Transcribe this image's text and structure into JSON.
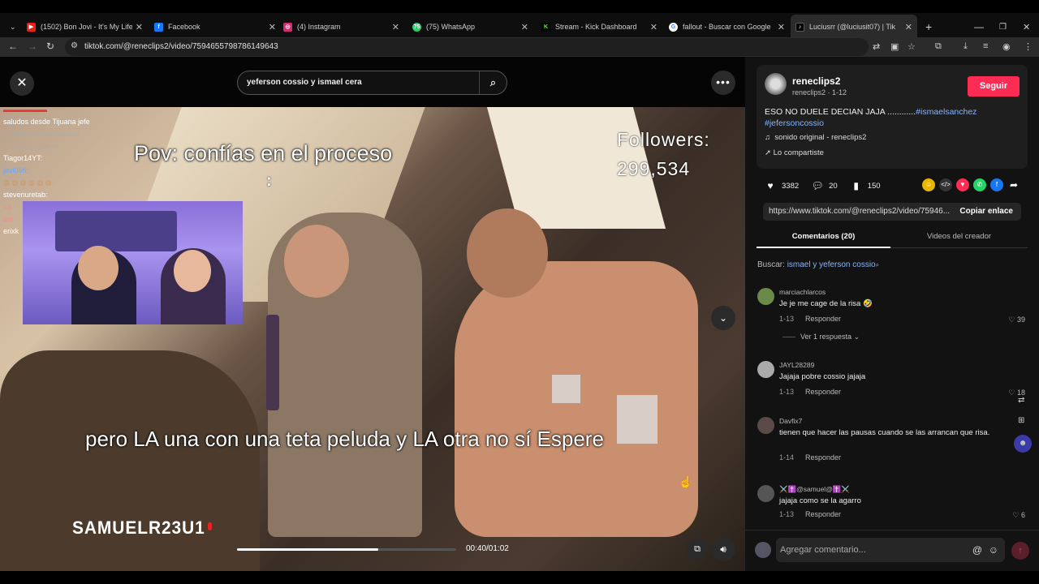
{
  "browser": {
    "tabs": [
      {
        "label": "(1502) Bon Jovi - It's My Life (O",
        "icon": "youtube-icon",
        "color": "#e62117"
      },
      {
        "label": "Facebook",
        "icon": "facebook-icon",
        "color": "#1877f2"
      },
      {
        "label": "(4) Instagram",
        "icon": "instagram-icon",
        "color": "#d62976"
      },
      {
        "label": "(75) WhatsApp",
        "icon": "whatsapp-icon",
        "color": "#25d366"
      },
      {
        "label": "Stream - Kick Dashboard",
        "icon": "kick-icon",
        "color": "#53fc18"
      },
      {
        "label": "fallout - Buscar con Google",
        "icon": "google-icon",
        "color": "#4285f4"
      },
      {
        "label": "Luciusrr (@luciusit07) | Tik",
        "icon": "tiktok-icon",
        "color": "#000000"
      }
    ],
    "url": "tiktok.com/@reneclips2/video/7594655798786149643"
  },
  "video": {
    "search_value": "yeferson cossio y ismael cera",
    "pov_text": "Pov: confías en el proceso",
    "colon": ":",
    "followers_label": "Followers:",
    "followers_count": "299,534",
    "bottom_text": "pero LA una con una teta peluda y LA otra no sí Espere",
    "watermark": "SAMUELR23U1",
    "time": "00:40/01:02",
    "progress": 0.645,
    "chat_lines": [
      "saludos desde Tijuana jefe",
      "Tiagor14YT:",
      "javi066:",
      "stevenuretab:",
      "sa",
      "sm",
      "erixk"
    ]
  },
  "panel": {
    "username": "reneclips2",
    "usersub": "reneclips2 · 1-12",
    "follow_label": "Seguir",
    "caption_text": "ESO NO DUELE DECIAN JAJA ............",
    "caption_tag1": "#ismaelsanchez",
    "caption_tag2": "#jefersoncossio",
    "sound": "sonido original - reneclips2",
    "shared": "Lo compartiste",
    "likes": "3382",
    "comments_count": "20",
    "saves": "150",
    "link": "https://www.tiktok.com/@reneclips2/video/75946...",
    "copy_label": "Copiar enlace",
    "tab_comments": "Comentarios (20)",
    "tab_videos": "Videos del creador",
    "buscar_label": "Buscar:",
    "buscar_term": "ismael y yeferson cossio",
    "comments": [
      {
        "user": "marciachlarcos",
        "text": "Je je me cage de la risa 🤣",
        "date": "1-13",
        "likes": "39"
      },
      {
        "user": "JAYL28289",
        "text": "Jajaja pobre cossio jajaja",
        "date": "1-13",
        "likes": "18"
      },
      {
        "user": "Davfix7",
        "text": "tienen que hacer las pausas cuando se las arrancan que risa.",
        "date": "1-14",
        "likes": ""
      },
      {
        "user": "⚔️✝️@samuel@✝️⚔️",
        "text": "jajaja como se la agarro",
        "date": "1-13",
        "likes": "6"
      }
    ],
    "reply_label": "Responder",
    "view_replies": "Ver 1 respuesta",
    "add_comment_placeholder": "Agregar comentario..."
  }
}
